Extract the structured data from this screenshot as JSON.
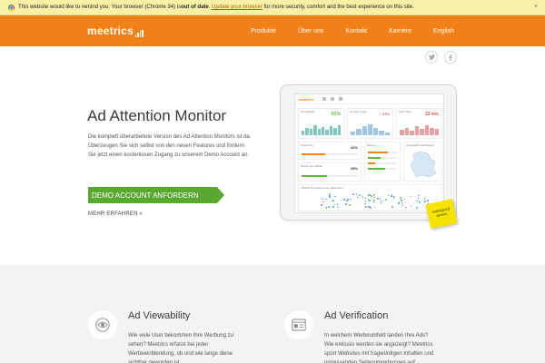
{
  "notice": {
    "text_before": "This website would like to remind you: Your browser (Chrome 34) is ",
    "bold": "out of date",
    "text_mid": ". ",
    "link": "Update your browser",
    "text_after": " for more security, comfort and the best experience on this site.",
    "close": "×"
  },
  "header": {
    "logo": "meetrics",
    "nav": [
      "Produkte",
      "Über uns",
      "Kontakt",
      "Karriere",
      "English"
    ]
  },
  "social": [
    "twitter-icon",
    "facebook-icon"
  ],
  "hero": {
    "title": "Ad Attention Monitor",
    "text": "Die komplett überarbeitete Version des Ad Attention Monitors ist da. Überzeugen Sie sich selbst von den neuen Features und fordern Sie jetzt einen kostenlosen Zugang zu unserem Demo Account an.",
    "cta": "DEMO ACCOUNT ANFORDERN",
    "more": "MEHR ERFAHREN »"
  },
  "dashboard": {
    "logo": "meetrics",
    "widgets": [
      {
        "title": "Ad Visibility",
        "value": "81%"
      },
      {
        "title": "Gender & Age",
        "value": "♀ 37%"
      },
      {
        "title": "View Time",
        "value": "13 sec"
      },
      {
        "title": "Fixed (1X)",
        "value": "42%"
      },
      {
        "title": "Device",
        "value": ""
      },
      {
        "title": "Geographic distribution",
        "value": ""
      },
      {
        "title": "Target your affinity",
        "value": "45%"
      },
      {
        "title": "Visibility & reach/ms per placement",
        "value": ""
      }
    ],
    "sticker": "redesigned version"
  },
  "features": [
    {
      "icon": "eye-icon",
      "title": "Ad Viewability",
      "text": "Wie viele User bekommen Ihre Werbung zu sehen? Meetrics erfasst bei jeder Werbeeinblendung, ob und wie lange diese sichtbar geworden ist."
    },
    {
      "icon": "browser-window-icon",
      "title": "Ad Verification",
      "text": "In welchem Werbeumfeld landen Ihre Ads? Wie exklusiv werden sie angezeigt? Meetrics spürt Websites mit fragwürdigen Inhalten und unpassenden Seitenumgebungen auf."
    }
  ],
  "colors": {
    "brand_orange": "#f28019",
    "cta_green": "#5aa832",
    "notice_bg": "#f9f0a8"
  }
}
